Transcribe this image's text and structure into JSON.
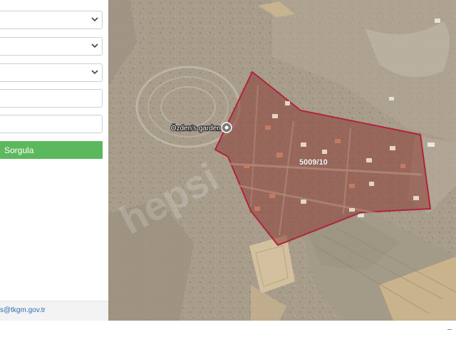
{
  "form": {
    "select_1": {
      "value": ""
    },
    "select_2": {
      "value": ""
    },
    "select_3": {
      "value": ""
    },
    "input_1": {
      "value": "",
      "placeholder": ""
    },
    "input_2": {
      "value": "",
      "placeholder": ""
    },
    "query_button_label": "Sorgula",
    "footer_email": "s@tkgm.gov.tr"
  },
  "map": {
    "parcel_label": "5009/10",
    "poi_label": "Özden's garden",
    "parcel_outline_color": "#b0243a",
    "watermark": "hepsi"
  },
  "colors": {
    "button_green": "#5cb85c"
  }
}
